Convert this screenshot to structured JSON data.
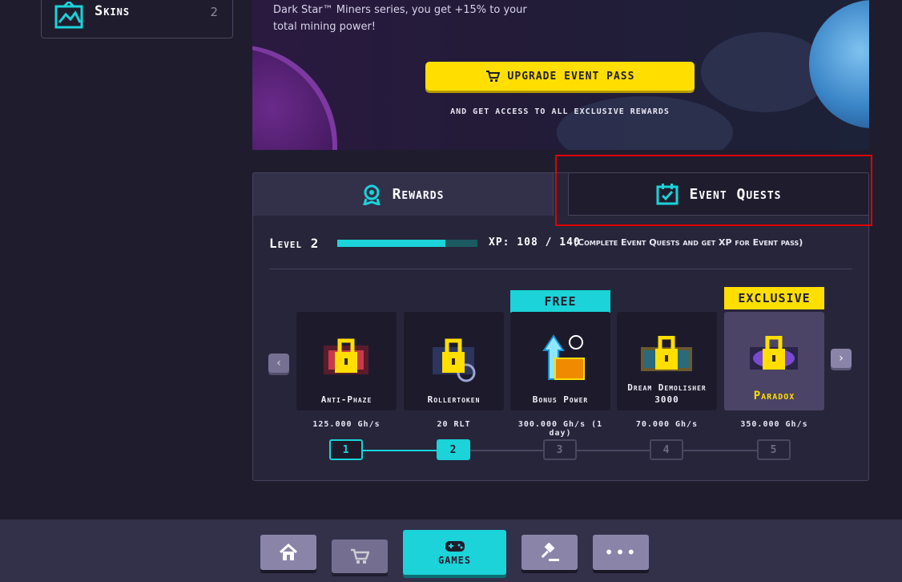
{
  "sidebar": {
    "skins": {
      "label": "Skins",
      "count": "2"
    }
  },
  "banner": {
    "text": "Dark Star™ Miners series, you get +15% to your total mining power!",
    "upgrade_button": "UPGRADE EVENT PASS",
    "upgrade_subtext": "AND GET ACCESS TO ALL EXCLUSIVE REWARDS"
  },
  "tabs": {
    "rewards": "Rewards",
    "event_quests": "Event Quests"
  },
  "level": {
    "label": "Level 2",
    "xp_text": "XP: 108 / 140",
    "xp_note": "(Complete Event Quests and get XP for Event pass)",
    "xp_current": 108,
    "xp_max": 140
  },
  "rewards": {
    "items": [
      {
        "name": "Anti-Phaze",
        "value": "125.000 Gh/s"
      },
      {
        "name": "Rollertoken",
        "value": "20 RLT"
      },
      {
        "name": "Bonus Power",
        "value": "300.000 Gh/s (1 day)",
        "badge": "FREE"
      },
      {
        "name": "Dream Demolisher 3000",
        "value": "70.000 Gh/s"
      },
      {
        "name": "Paradox",
        "value": "350.000 Gh/s",
        "badge": "EXCLUSIVE"
      }
    ],
    "steps": [
      "1",
      "2",
      "3",
      "4",
      "5"
    ]
  },
  "bottom_nav": {
    "games": "GAMES"
  },
  "colors": {
    "accent": "#1bd3d8",
    "gold": "#ffde00",
    "highlight": "#e00000"
  }
}
